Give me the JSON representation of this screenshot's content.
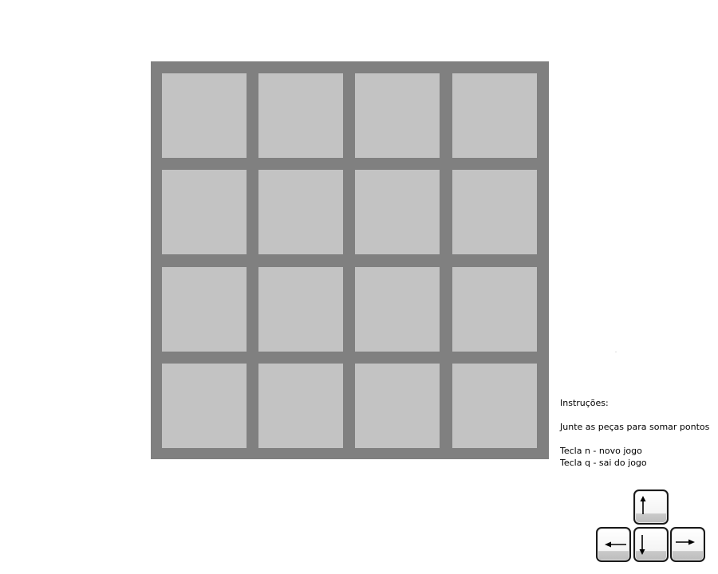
{
  "board": {
    "size": 4,
    "tiles": [
      [
        "",
        "",
        "",
        ""
      ],
      [
        "",
        "",
        "",
        ""
      ],
      [
        "",
        "",
        "",
        ""
      ],
      [
        "",
        "",
        "",
        ""
      ]
    ]
  },
  "instructions": {
    "title": "Instruções:",
    "objective": "Junte as peças para somar pontos",
    "new_game": "Tecla n - novo jogo",
    "quit": "Tecla q - sai do jogo"
  },
  "controls": {
    "keys": [
      "up",
      "left",
      "down",
      "right"
    ]
  },
  "colors": {
    "board_background": "#808080",
    "empty_tile": "#c3c3c3"
  }
}
